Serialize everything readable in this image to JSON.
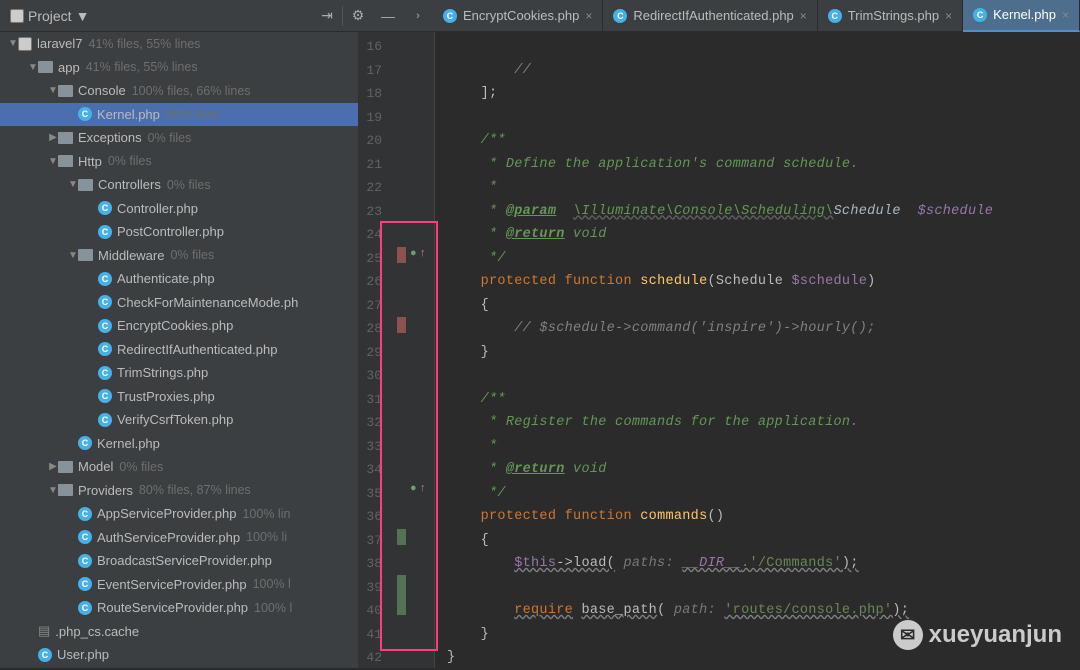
{
  "toolbar": {
    "project_label": "Project"
  },
  "tabs": [
    {
      "name": "EncryptCookies.php"
    },
    {
      "name": "RedirectIfAuthenticated.php"
    },
    {
      "name": "TrimStrings.php"
    },
    {
      "name": "Kernel.php",
      "active": true
    }
  ],
  "tree": [
    {
      "indent": 0,
      "chev": "▼",
      "icon": "proj",
      "label": "laravel7",
      "dim": "41% files, 55% lines"
    },
    {
      "indent": 1,
      "chev": "▼",
      "icon": "folder",
      "label": "app",
      "dim": "41% files, 55% lines"
    },
    {
      "indent": 2,
      "chev": "▼",
      "icon": "folder",
      "label": "Console",
      "dim": "100% files, 66% lines"
    },
    {
      "indent": 3,
      "chev": "",
      "icon": "file",
      "label": "Kernel.php",
      "dim": "66% lines",
      "selected": true
    },
    {
      "indent": 2,
      "chev": "▶",
      "icon": "folder",
      "label": "Exceptions",
      "dim": "0% files"
    },
    {
      "indent": 2,
      "chev": "▼",
      "icon": "folder",
      "label": "Http",
      "dim": "0% files"
    },
    {
      "indent": 3,
      "chev": "▼",
      "icon": "folder",
      "label": "Controllers",
      "dim": "0% files"
    },
    {
      "indent": 4,
      "chev": "",
      "icon": "file",
      "label": "Controller.php",
      "dim": ""
    },
    {
      "indent": 4,
      "chev": "",
      "icon": "file",
      "label": "PostController.php",
      "dim": ""
    },
    {
      "indent": 3,
      "chev": "▼",
      "icon": "folder",
      "label": "Middleware",
      "dim": "0% files"
    },
    {
      "indent": 4,
      "chev": "",
      "icon": "file",
      "label": "Authenticate.php",
      "dim": ""
    },
    {
      "indent": 4,
      "chev": "",
      "icon": "file",
      "label": "CheckForMaintenanceMode.ph",
      "dim": ""
    },
    {
      "indent": 4,
      "chev": "",
      "icon": "file",
      "label": "EncryptCookies.php",
      "dim": ""
    },
    {
      "indent": 4,
      "chev": "",
      "icon": "file",
      "label": "RedirectIfAuthenticated.php",
      "dim": ""
    },
    {
      "indent": 4,
      "chev": "",
      "icon": "file",
      "label": "TrimStrings.php",
      "dim": ""
    },
    {
      "indent": 4,
      "chev": "",
      "icon": "file",
      "label": "TrustProxies.php",
      "dim": ""
    },
    {
      "indent": 4,
      "chev": "",
      "icon": "file",
      "label": "VerifyCsrfToken.php",
      "dim": ""
    },
    {
      "indent": 3,
      "chev": "",
      "icon": "file",
      "label": "Kernel.php",
      "dim": ""
    },
    {
      "indent": 2,
      "chev": "▶",
      "icon": "folder",
      "label": "Model",
      "dim": "0% files"
    },
    {
      "indent": 2,
      "chev": "▼",
      "icon": "folder",
      "label": "Providers",
      "dim": "80% files, 87% lines"
    },
    {
      "indent": 3,
      "chev": "",
      "icon": "file",
      "label": "AppServiceProvider.php",
      "dim": "100% lin"
    },
    {
      "indent": 3,
      "chev": "",
      "icon": "file",
      "label": "AuthServiceProvider.php",
      "dim": "100% li"
    },
    {
      "indent": 3,
      "chev": "",
      "icon": "file",
      "label": "BroadcastServiceProvider.php",
      "dim": ""
    },
    {
      "indent": 3,
      "chev": "",
      "icon": "file",
      "label": "EventServiceProvider.php",
      "dim": "100% l"
    },
    {
      "indent": 3,
      "chev": "",
      "icon": "file",
      "label": "RouteServiceProvider.php",
      "dim": "100% l"
    },
    {
      "indent": 1,
      "chev": "",
      "icon": "txt",
      "label": ".php_cs.cache",
      "dim": ""
    },
    {
      "indent": 1,
      "chev": "",
      "icon": "file",
      "label": "User.php",
      "dim": ""
    }
  ],
  "line_numbers": [
    "16",
    "17",
    "18",
    "19",
    "20",
    "21",
    "22",
    "23",
    "24",
    "25",
    "26",
    "27",
    "28",
    "29",
    "30",
    "31",
    "32",
    "33",
    "34",
    "35",
    "36",
    "37",
    "38",
    "39",
    "40",
    "41",
    "42"
  ],
  "code": {
    "l16": "//",
    "l17": "];",
    "doc_define": "Define the application's command schedule.",
    "doc_param": "@param",
    "doc_param_type": "\\Illuminate\\Console\\Scheduling\\",
    "doc_param_type2": "Schedule",
    "doc_param_var": "$schedule",
    "doc_return": "@return",
    "doc_void": "void",
    "kw_protected": "protected",
    "kw_function": "function",
    "fn_schedule": "schedule",
    "type_schedule": "Schedule",
    "var_schedule": "$schedule",
    "inspire_comment": "// $schedule->command('inspire')->hourly();",
    "doc_register": "Register the commands for the application.",
    "fn_commands": "commands",
    "var_this": "$this",
    "load_call": "->load(",
    "hint_paths": " paths: ",
    "const_dir": "__DIR__",
    "str_commands": ".'/Commands'",
    "kw_require": "require",
    "fn_basepath": "base_path",
    "hint_path": " path: ",
    "str_routes": "'routes/console.php'"
  },
  "watermark": "xueyuanjun"
}
